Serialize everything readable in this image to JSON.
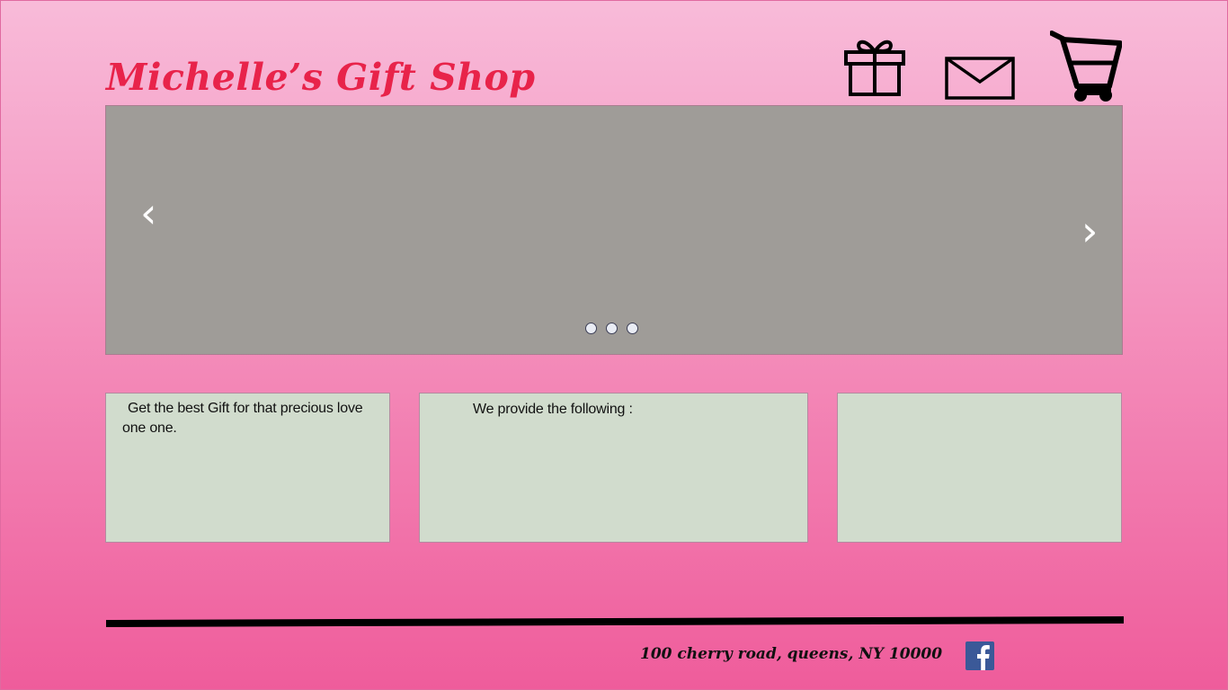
{
  "header": {
    "title": "Michelle’s Gift Shop"
  },
  "icons": {
    "gift": "gift-icon",
    "mail": "envelope-icon",
    "cart": "shopping-cart-icon",
    "facebook": "facebook-icon"
  },
  "carousel": {
    "prev_label": "‹",
    "next_label": "›",
    "slide_count": 3
  },
  "panels": [
    {
      "text": "Get the best Gift for that precious love one one."
    },
    {
      "text": "We provide the following :"
    },
    {
      "text": ""
    }
  ],
  "footer": {
    "address": "100 cherry road, queens, NY 10000"
  },
  "colors": {
    "brand": "#e8234a",
    "carousel_bg": "#9f9c98",
    "panel_bg": "#d1dccd",
    "facebook": "#3b5998"
  }
}
